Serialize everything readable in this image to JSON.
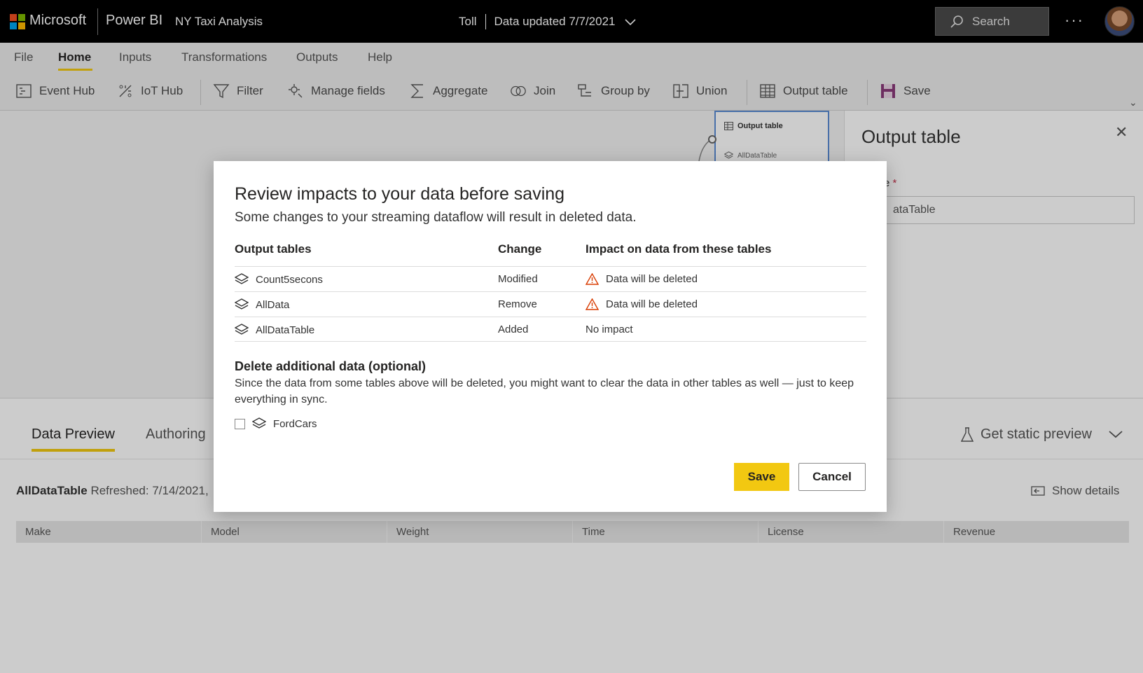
{
  "topbar": {
    "brand": "Microsoft",
    "product": "Power BI",
    "report_name": "NY Taxi Analysis",
    "workspace": "Toll",
    "data_updated": "Data updated 7/7/2021",
    "search_placeholder": "Search",
    "more_label": "···"
  },
  "menu": {
    "tabs": [
      "File",
      "Home",
      "Inputs",
      "Transformations",
      "Outputs",
      "Help"
    ],
    "active": "Home"
  },
  "ribbon": {
    "items": [
      "Event Hub",
      "IoT Hub",
      "Filter",
      "Manage fields",
      "Aggregate",
      "Join",
      "Group by",
      "Union",
      "Output table",
      "Save"
    ]
  },
  "canvas": {
    "node_title": "Output table",
    "node_sub": "AllDataTable"
  },
  "right_panel": {
    "title": "Output table",
    "field_label": "e",
    "field_required": "*",
    "field_value": "ataTable"
  },
  "bottom": {
    "tabs": [
      "Data Preview",
      "Authoring"
    ],
    "static_preview": "Get static preview",
    "table_name": "AllDataTable",
    "refreshed": "Refreshed: 7/14/2021,",
    "show_details": "Show details",
    "columns": [
      "Make",
      "Model",
      "Weight",
      "Time",
      "License",
      "Revenue"
    ]
  },
  "dialog": {
    "title": "Review impacts to your data before saving",
    "subtitle": "Some changes to your streaming dataflow will result in deleted data.",
    "headers": {
      "tables": "Output tables",
      "change": "Change",
      "impact": "Impact on data from these tables"
    },
    "rows": [
      {
        "table": "Count5secons",
        "change": "Modified",
        "impact": "Data will be deleted",
        "warn": true
      },
      {
        "table": "AllData",
        "change": "Remove",
        "impact": "Data will be deleted",
        "warn": true
      },
      {
        "table": "AllDataTable",
        "change": "Added",
        "impact": "No impact",
        "warn": false
      }
    ],
    "delete_heading": "Delete additional data (optional)",
    "delete_text": "Since the data from some tables above will be deleted, you might want to clear the data in other tables as well — just to keep everything in sync.",
    "extra_table": "FordCars",
    "save_label": "Save",
    "cancel_label": "Cancel"
  },
  "colors": {
    "accent": "#f2c811",
    "warning": "#d83b01",
    "topbar": "#000000"
  }
}
